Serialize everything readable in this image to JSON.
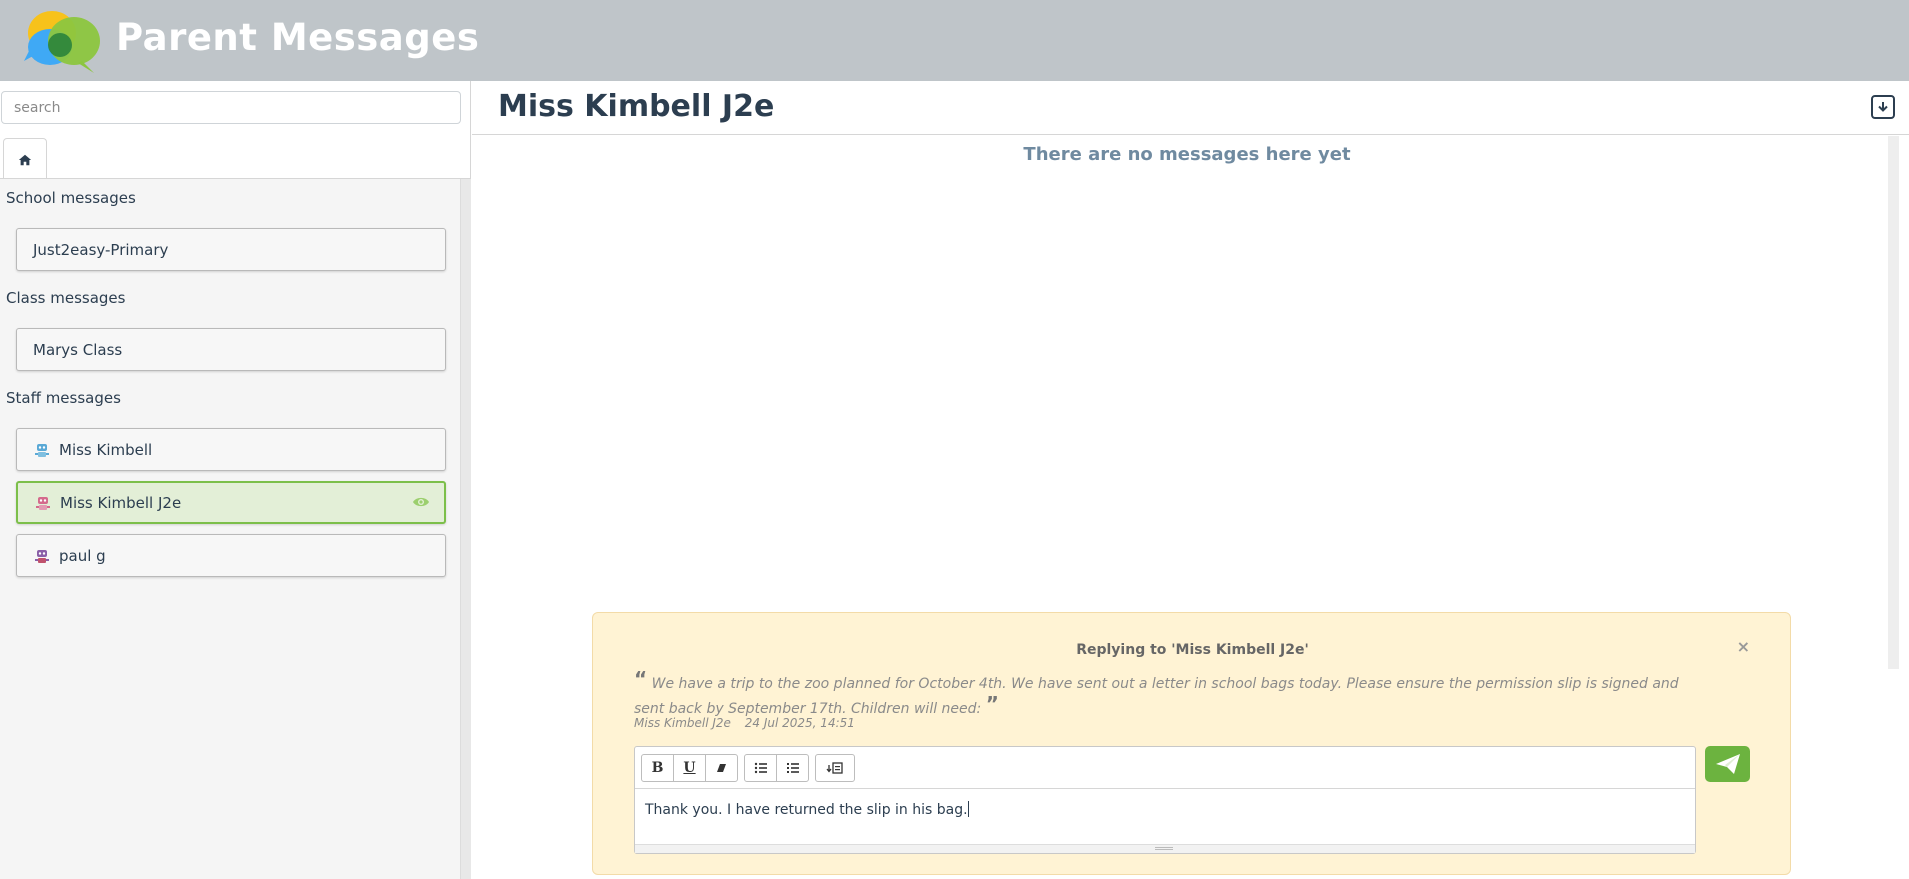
{
  "app": {
    "title": "Parent Messages"
  },
  "search": {
    "placeholder": "search"
  },
  "sections": {
    "school": {
      "title": "School messages",
      "items": [
        {
          "label": "Just2easy-Primary"
        }
      ]
    },
    "class": {
      "title": "Class messages",
      "items": [
        {
          "label": "Marys Class"
        }
      ]
    },
    "staff": {
      "title": "Staff messages",
      "items": [
        {
          "label": "Miss Kimbell",
          "avatar": "robot-avatar-blue"
        },
        {
          "label": "Miss Kimbell J2e",
          "avatar": "robot-avatar-pink",
          "active": true
        },
        {
          "label": "paul g",
          "avatar": "robot-avatar-purple"
        }
      ]
    }
  },
  "conversation": {
    "title": "Miss Kimbell J2e",
    "empty_text": "There are no messages here yet"
  },
  "reply": {
    "heading": "Replying to 'Miss Kimbell J2e'",
    "close_label": "×",
    "quote_text": "We have a trip to the zoo planned for October 4th. We have sent out a letter in school bags today. Please ensure the permission slip is signed and sent back by September 17th.  Children will need:",
    "quote_author": "Miss Kimbell J2e",
    "quote_time": "24 Jul 2025, 14:51",
    "editor_text": "Thank you. I have returned the slip in his bag.",
    "toolbar": {
      "bold": "B",
      "underline": "U"
    }
  },
  "colors": {
    "header": "#bfc5c9",
    "accent": "#7cbf4a",
    "send": "#6cb33f",
    "reply_bg": "#fff3d4"
  }
}
